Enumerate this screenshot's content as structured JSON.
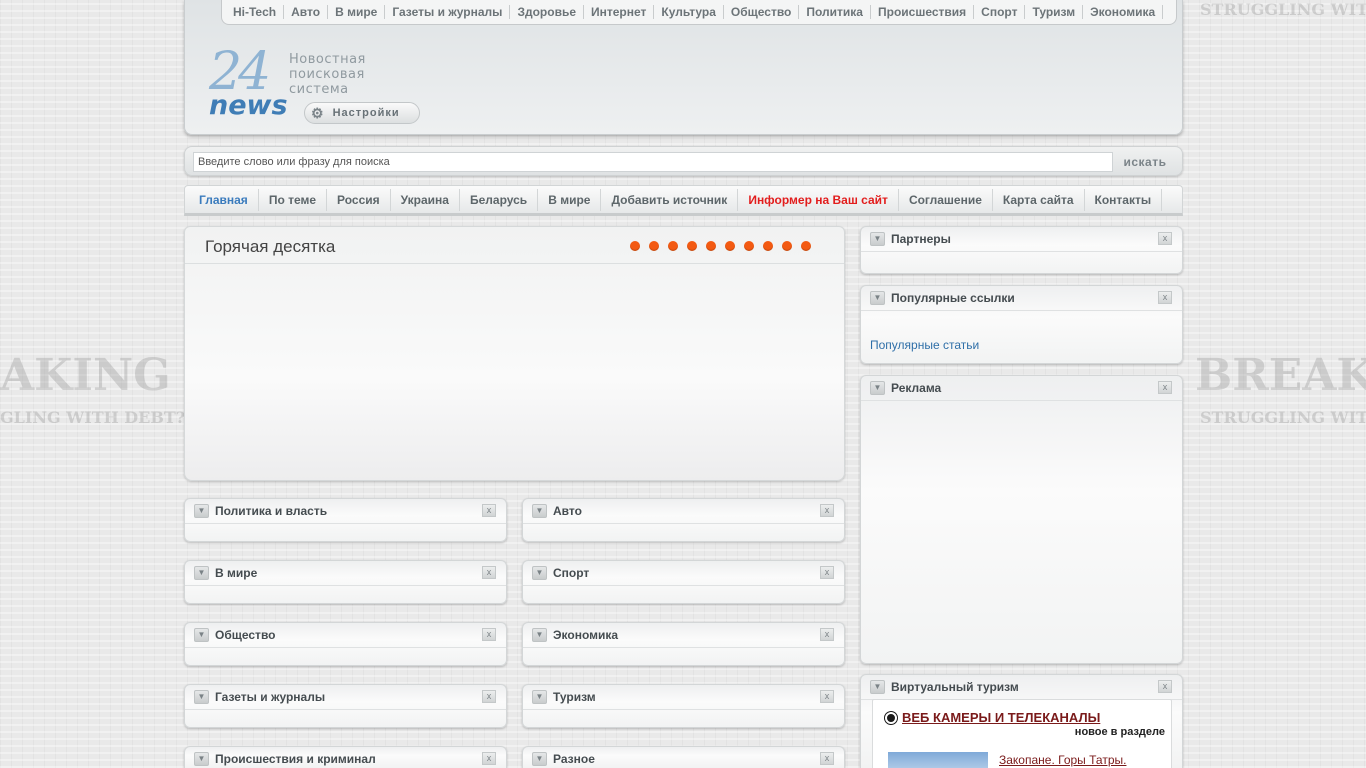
{
  "top_categories": [
    "Hi-Tech",
    "Авто",
    "В мире",
    "Газеты и журналы",
    "Здоровье",
    "Интернет",
    "Культура",
    "Общество",
    "Политика",
    "Происшествия",
    "Спорт",
    "Туризм",
    "Экономика"
  ],
  "logo": {
    "number": "24",
    "word": "news",
    "tagline_1": "Новостная",
    "tagline_2": "поисковая",
    "tagline_3": "система"
  },
  "settings_label": "Настройки",
  "search": {
    "value": "Введите слово или фразу для поиска",
    "button_label": "искать"
  },
  "main_nav": [
    {
      "label": "Главная",
      "state": "active"
    },
    {
      "label": "По теме",
      "state": ""
    },
    {
      "label": "Россия",
      "state": ""
    },
    {
      "label": "Украина",
      "state": ""
    },
    {
      "label": "Беларусь",
      "state": ""
    },
    {
      "label": "В мире",
      "state": ""
    },
    {
      "label": "Добавить источник",
      "state": ""
    },
    {
      "label": "Информер на Ваш сайт",
      "state": "red"
    },
    {
      "label": "Соглашение",
      "state": ""
    },
    {
      "label": "Карта сайта",
      "state": ""
    },
    {
      "label": "Контакты",
      "state": ""
    }
  ],
  "hot_ten": {
    "title": "Горячая десятка",
    "dot_count": 10
  },
  "box_glyphs": {
    "toggle": "▼",
    "close": "x"
  },
  "category_boxes": {
    "politics": "Политика и власть",
    "auto": "Авто",
    "world": "В мире",
    "sport": "Спорт",
    "society": "Общество",
    "economy": "Экономика",
    "press": "Газеты и журналы",
    "tourism": "Туризм",
    "incidents": "Происшествия и криминал",
    "misc": "Разное"
  },
  "sidebar": {
    "partners_title": "Партнеры",
    "popular_links_title": "Популярные ссылки",
    "popular_articles_link": "Популярные статьи",
    "ads_title": "Реклама",
    "virtual_tourism_title": "Виртуальный туризм",
    "webcams_headline": "ВЕБ КАМЕРЫ И ТЕЛЕКАНАЛЫ",
    "new_in_section": "новое в разделе",
    "featured_link": "Закопане. Горы Татры."
  },
  "colors": {
    "accent_orange": "#f35a12",
    "link_blue": "#2f6fa8",
    "active_nav_blue": "#3a7bbd",
    "informer_red": "#e21d1d",
    "webcam_maroon": "#7a1a1a"
  }
}
